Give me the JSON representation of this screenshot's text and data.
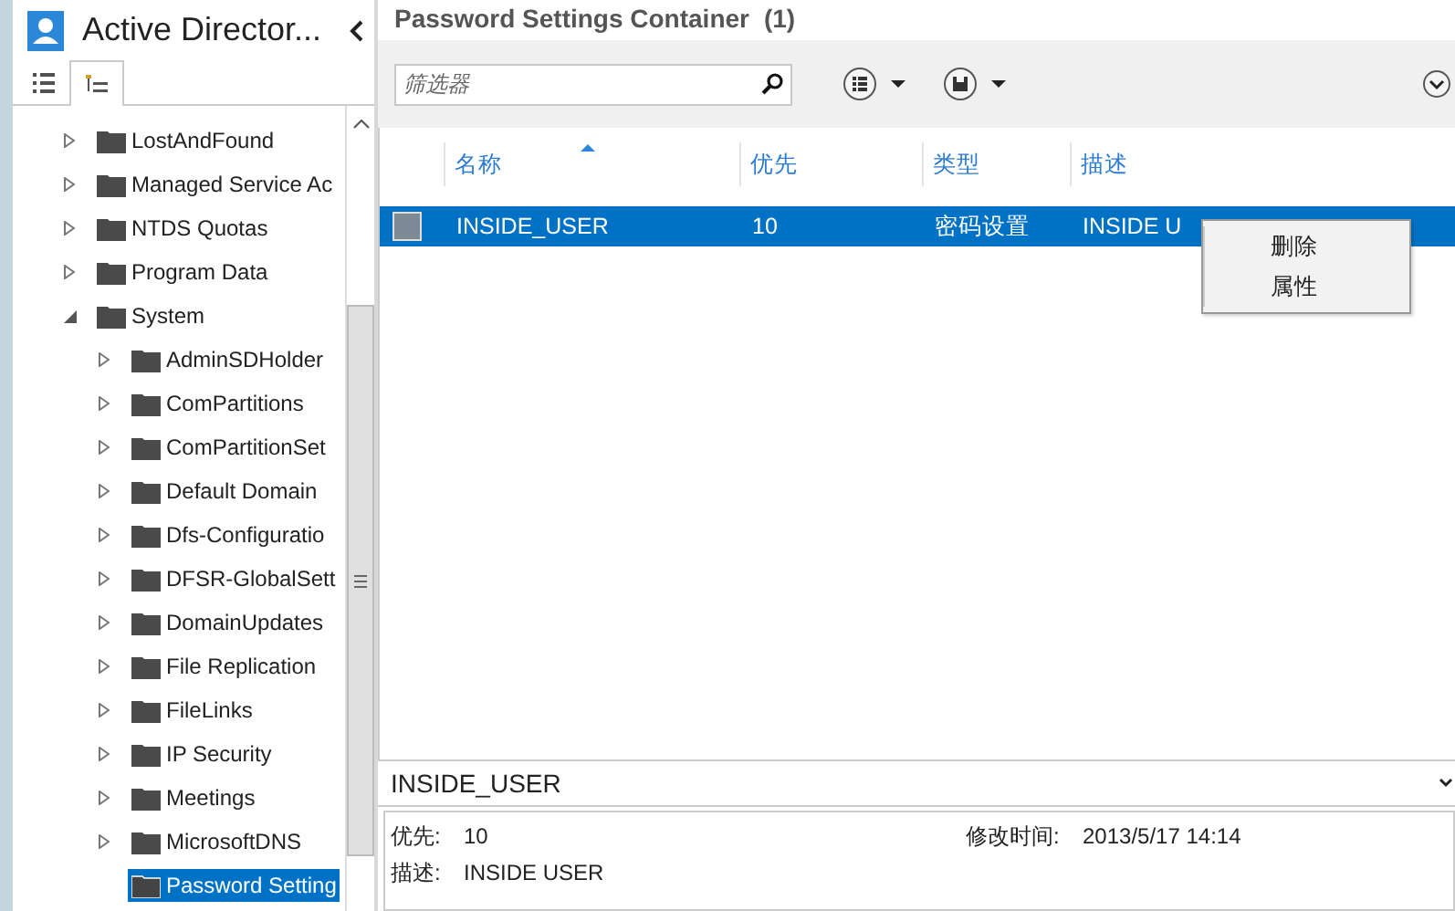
{
  "navigation": {
    "title": "Active Director...",
    "view_tabs": [
      {
        "kind": "list",
        "selected": false
      },
      {
        "kind": "tree",
        "selected": true
      }
    ],
    "tree": [
      {
        "label": "LostAndFound",
        "expanded": false,
        "selected": false
      },
      {
        "label": "Managed Service Ac",
        "expanded": false,
        "selected": false
      },
      {
        "label": "NTDS Quotas",
        "expanded": false,
        "selected": false
      },
      {
        "label": "Program Data",
        "expanded": false,
        "selected": false
      },
      {
        "label": "System",
        "expanded": true,
        "selected": false,
        "children": [
          {
            "label": "AdminSDHolder",
            "expanded": false,
            "selected": false
          },
          {
            "label": "ComPartitions",
            "expanded": false,
            "selected": false
          },
          {
            "label": "ComPartitionSet",
            "expanded": false,
            "selected": false
          },
          {
            "label": "Default Domain",
            "expanded": false,
            "selected": false
          },
          {
            "label": "Dfs-Configuratio",
            "expanded": false,
            "selected": false
          },
          {
            "label": "DFSR-GlobalSett",
            "expanded": false,
            "selected": false
          },
          {
            "label": "DomainUpdates",
            "expanded": false,
            "selected": false
          },
          {
            "label": "File Replication",
            "expanded": false,
            "selected": false
          },
          {
            "label": "FileLinks",
            "expanded": false,
            "selected": false
          },
          {
            "label": "IP Security",
            "expanded": false,
            "selected": false
          },
          {
            "label": "Meetings",
            "expanded": false,
            "selected": false
          },
          {
            "label": "MicrosoftDNS",
            "expanded": false,
            "selected": false
          },
          {
            "label": "Password Setting",
            "selected": true
          }
        ]
      }
    ]
  },
  "content": {
    "title": "Password Settings Container",
    "count": "(1)",
    "filter": {
      "placeholder": "筛选器"
    },
    "table": {
      "columns": [
        {
          "label": "名称",
          "sorted": true
        },
        {
          "label": "优先",
          "sorted": false
        },
        {
          "label": "类型",
          "sorted": false
        },
        {
          "label": "描述",
          "sorted": false
        }
      ],
      "rows": [
        {
          "selected": true,
          "cells": [
            "INSIDE_USER",
            "10",
            "密码设置",
            "INSIDE U"
          ]
        }
      ]
    },
    "context_menu": [
      "删除",
      "属性"
    ],
    "details": {
      "title": "INSIDE_USER",
      "fields": [
        {
          "label": "优先:",
          "value": "10"
        },
        {
          "label": "描述:",
          "value": "INSIDE USER"
        }
      ],
      "modified": {
        "label": "修改时间:",
        "value": "2013/5/17 14:14"
      }
    }
  }
}
